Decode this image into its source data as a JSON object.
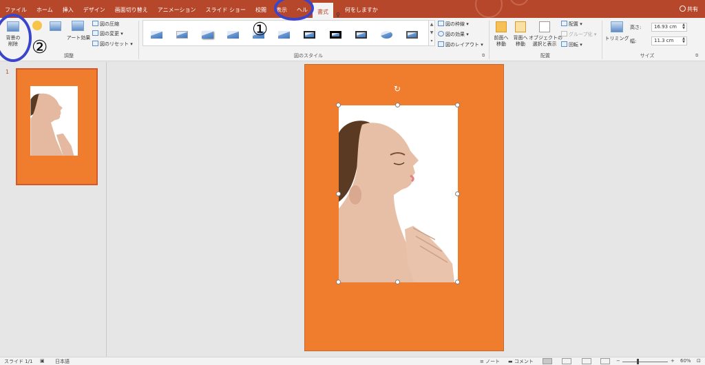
{
  "tabs": [
    "ファイル",
    "ホーム",
    "挿入",
    "デザイン",
    "画面切り替え",
    "アニメーション",
    "スライド ショー",
    "校閲",
    "表示",
    "ヘル",
    "書式",
    "何をしますか"
  ],
  "active_tab": "書式",
  "share_label": "共有",
  "help_icon": "lightbulb-icon",
  "ribbon": {
    "remove_bg_label": "背景の\n削除",
    "art_effects_label": "アート効果",
    "compress_label": "図の圧縮",
    "change_label": "図の変更",
    "reset_label": "図のリセット",
    "adjust_group": "調整",
    "border_label": "図の枠線",
    "effects_label": "図の効果",
    "layout_label": "図のレイアウト",
    "styles_group": "図のスタイル",
    "bring_forward_label": "前面へ\n移動",
    "send_backward_label": "背面へ\n移動",
    "selection_label": "オブジェクトの\n選択と表示",
    "align_label": "配置",
    "group_label": "グループ化",
    "rotate_label": "回転",
    "arrange_group": "配置",
    "crop_label": "トリミング",
    "height_label": "高さ:",
    "height_value": "16.93 cm",
    "width_label": "幅:",
    "width_value": "11.3 cm",
    "size_group": "サイズ"
  },
  "slide_number": "1",
  "status": {
    "slide_info": "スライド 1/1",
    "language": "日本語",
    "notes": "ノート",
    "comments": "コメント",
    "zoom": "60%"
  },
  "annotations": {
    "one": "①",
    "two": "②"
  },
  "colors": {
    "tab_bar": "#b7472a",
    "slide_bg": "#ef7d2d",
    "annotation": "#3c44c9"
  }
}
